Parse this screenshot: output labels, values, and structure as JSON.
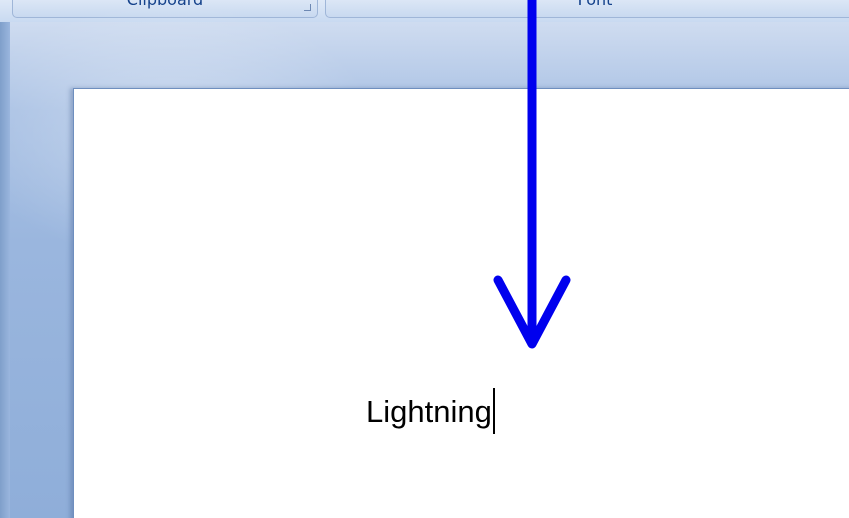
{
  "ribbon": {
    "groups": [
      {
        "label": "Clipboard"
      },
      {
        "label": "Font"
      }
    ]
  },
  "document": {
    "text": "Lightning"
  },
  "colors": {
    "arrow": "#0000ee",
    "workspace": "#9ab6de",
    "ribbon_text": "#15428b"
  }
}
